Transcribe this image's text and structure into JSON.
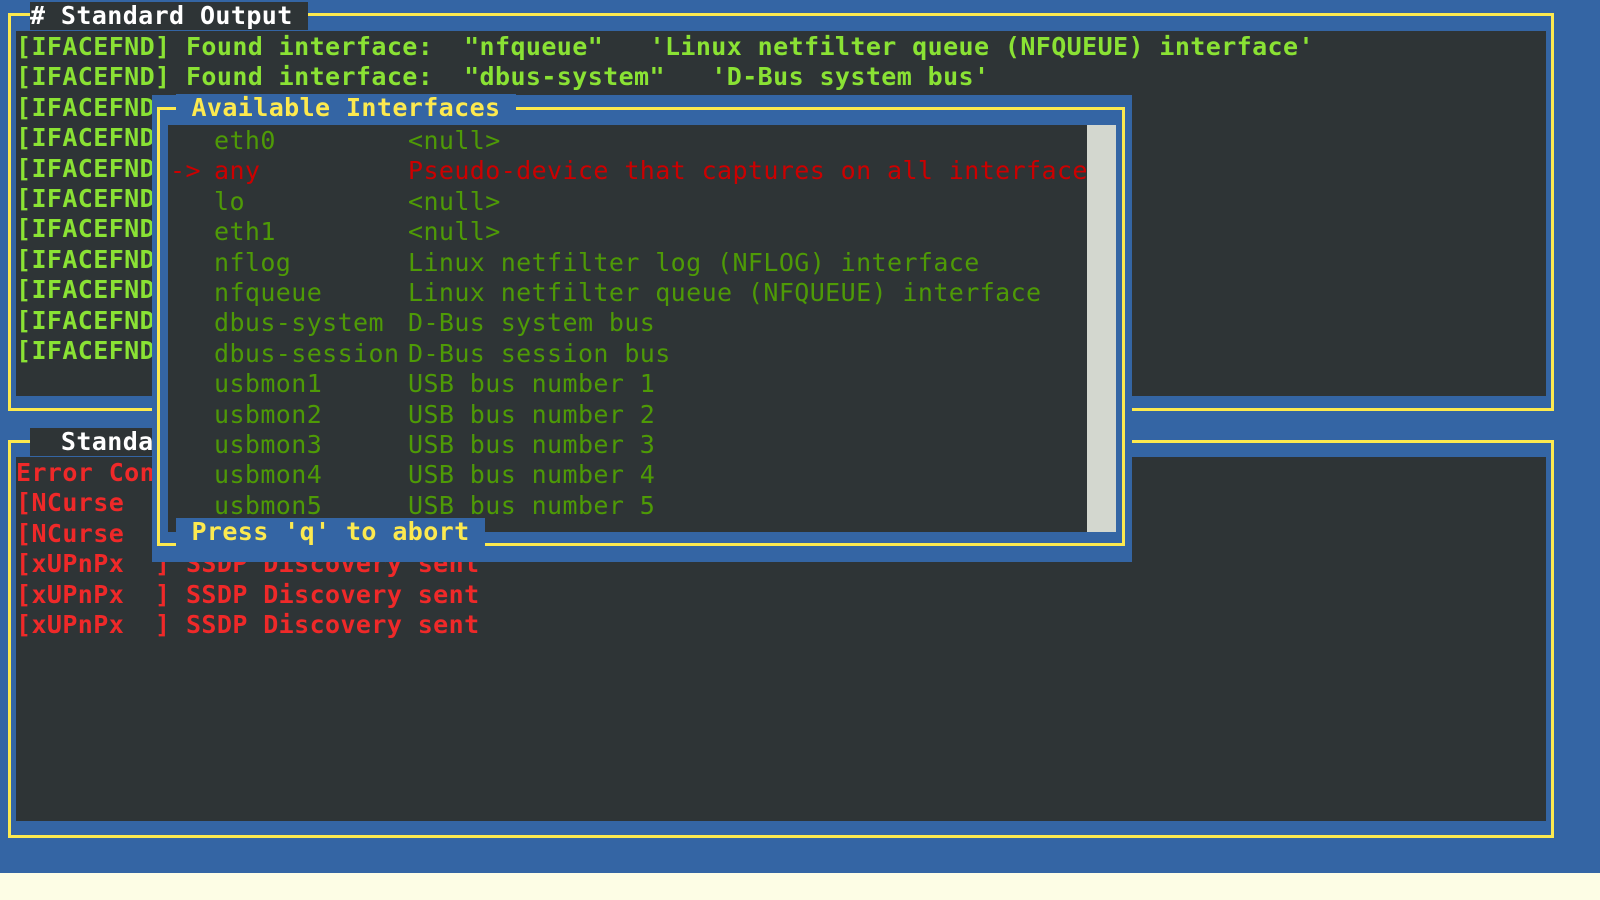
{
  "stdout": {
    "title": "# Standard Output ",
    "lines": [
      "[IFACEFND] Found interface:  \"nfqueue\"   'Linux netfilter queue (NFQUEUE) interface'",
      "[IFACEFND] Found interface:  \"dbus-system\"   'D-Bus system bus'",
      "[IFACEFND",
      "[IFACEFND",
      "[IFACEFND",
      "[IFACEFND",
      "[IFACEFND",
      "[IFACEFND",
      "[IFACEFND",
      "[IFACEFND",
      "[IFACEFND"
    ]
  },
  "stderr": {
    "title": "  Standa",
    "lines": [
      "Error Con",
      "[NCurse",
      "[NCurse",
      "[xUPnPx  ] SSDP Discovery sent",
      "[xUPnPx  ] SSDP Discovery sent",
      "[xUPnPx  ] SSDP Discovery sent"
    ]
  },
  "popup": {
    "title": " Available Interfaces ",
    "footer": " Press 'q' to abort ",
    "selected_marker": "->",
    "selected_index": 1,
    "items": [
      {
        "name": "eth0",
        "desc": "<null>"
      },
      {
        "name": "any",
        "desc": "Pseudo-device that captures on all interfaces"
      },
      {
        "name": "lo",
        "desc": "<null>"
      },
      {
        "name": "eth1",
        "desc": "<null>"
      },
      {
        "name": "nflog",
        "desc": "Linux netfilter log (NFLOG) interface"
      },
      {
        "name": "nfqueue",
        "desc": "Linux netfilter queue (NFQUEUE) interface"
      },
      {
        "name": "dbus-system",
        "desc": "D-Bus system bus"
      },
      {
        "name": "dbus-session",
        "desc": "D-Bus session bus"
      },
      {
        "name": "usbmon1",
        "desc": "USB bus number 1"
      },
      {
        "name": "usbmon2",
        "desc": "USB bus number 2"
      },
      {
        "name": "usbmon3",
        "desc": "USB bus number 3"
      },
      {
        "name": "usbmon4",
        "desc": "USB bus number 4"
      },
      {
        "name": "usbmon5",
        "desc": "USB bus number 5"
      }
    ]
  },
  "colors": {
    "frame_blue": "#3465a4",
    "border_yellow": "#fce94f",
    "panel_bg": "#2e3436",
    "stdout_text": "#8ae234",
    "stderr_text": "#ef2929",
    "item_text": "#4e9a06",
    "selected_text": "#cc0000",
    "scrollbar": "#d3d7cf"
  }
}
